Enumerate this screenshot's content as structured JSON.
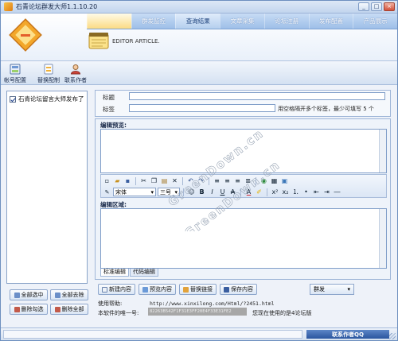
{
  "window": {
    "title": "石青论坛群发大师1.1.10.20",
    "buttons": [
      "_",
      "□",
      "×"
    ]
  },
  "banner": {
    "editor_label": "EDITOR ARTICLE."
  },
  "nav": {
    "tabs": [
      "",
      "群发监控",
      "查询结果",
      "文章采集",
      "论坛注册",
      "发布配置",
      "产品展示"
    ]
  },
  "toolbar": {
    "items": [
      "帐号配置",
      "替换配制",
      "联系作者"
    ]
  },
  "left_panel": {
    "items": [
      {
        "label": "石青论坛留言大师发布了",
        "checked": true
      }
    ],
    "buttons": [
      "全部选中",
      "全部去除",
      "删除勾选",
      "删除全部"
    ]
  },
  "form": {
    "title_label": "标题",
    "title_value": "",
    "tags_label": "标签",
    "tags_value": "",
    "tags_hint": "用空格隔开多个标签，最少可填写 5 个"
  },
  "editor": {
    "preview_label": "编辑预览:",
    "edit_label": "编辑区域:",
    "font_name": "宋体",
    "font_size": "三号",
    "tabs": [
      "标准编辑",
      "代码编辑"
    ]
  },
  "actions": [
    "新建内容",
    "预览内容",
    "替换链接",
    "保存内容"
  ],
  "group_select": "群发",
  "help": {
    "label": "使用帮助:",
    "url": "http://www.xinxilong.com/Html/?2451.html"
  },
  "serial": {
    "label": "本软件的唯一号:",
    "value": "82263B542F1F31E3FF20E4F33E31FE2",
    "note": "您现在使用的是4论坛版"
  },
  "statusbar": {
    "contact": "联系作者QQ"
  },
  "watermark": {
    "text": "GreenDown.cn"
  },
  "colors": {
    "accent": "#2a559e",
    "nav_active": "#fbdb84",
    "frame": "#6d8fbf"
  }
}
